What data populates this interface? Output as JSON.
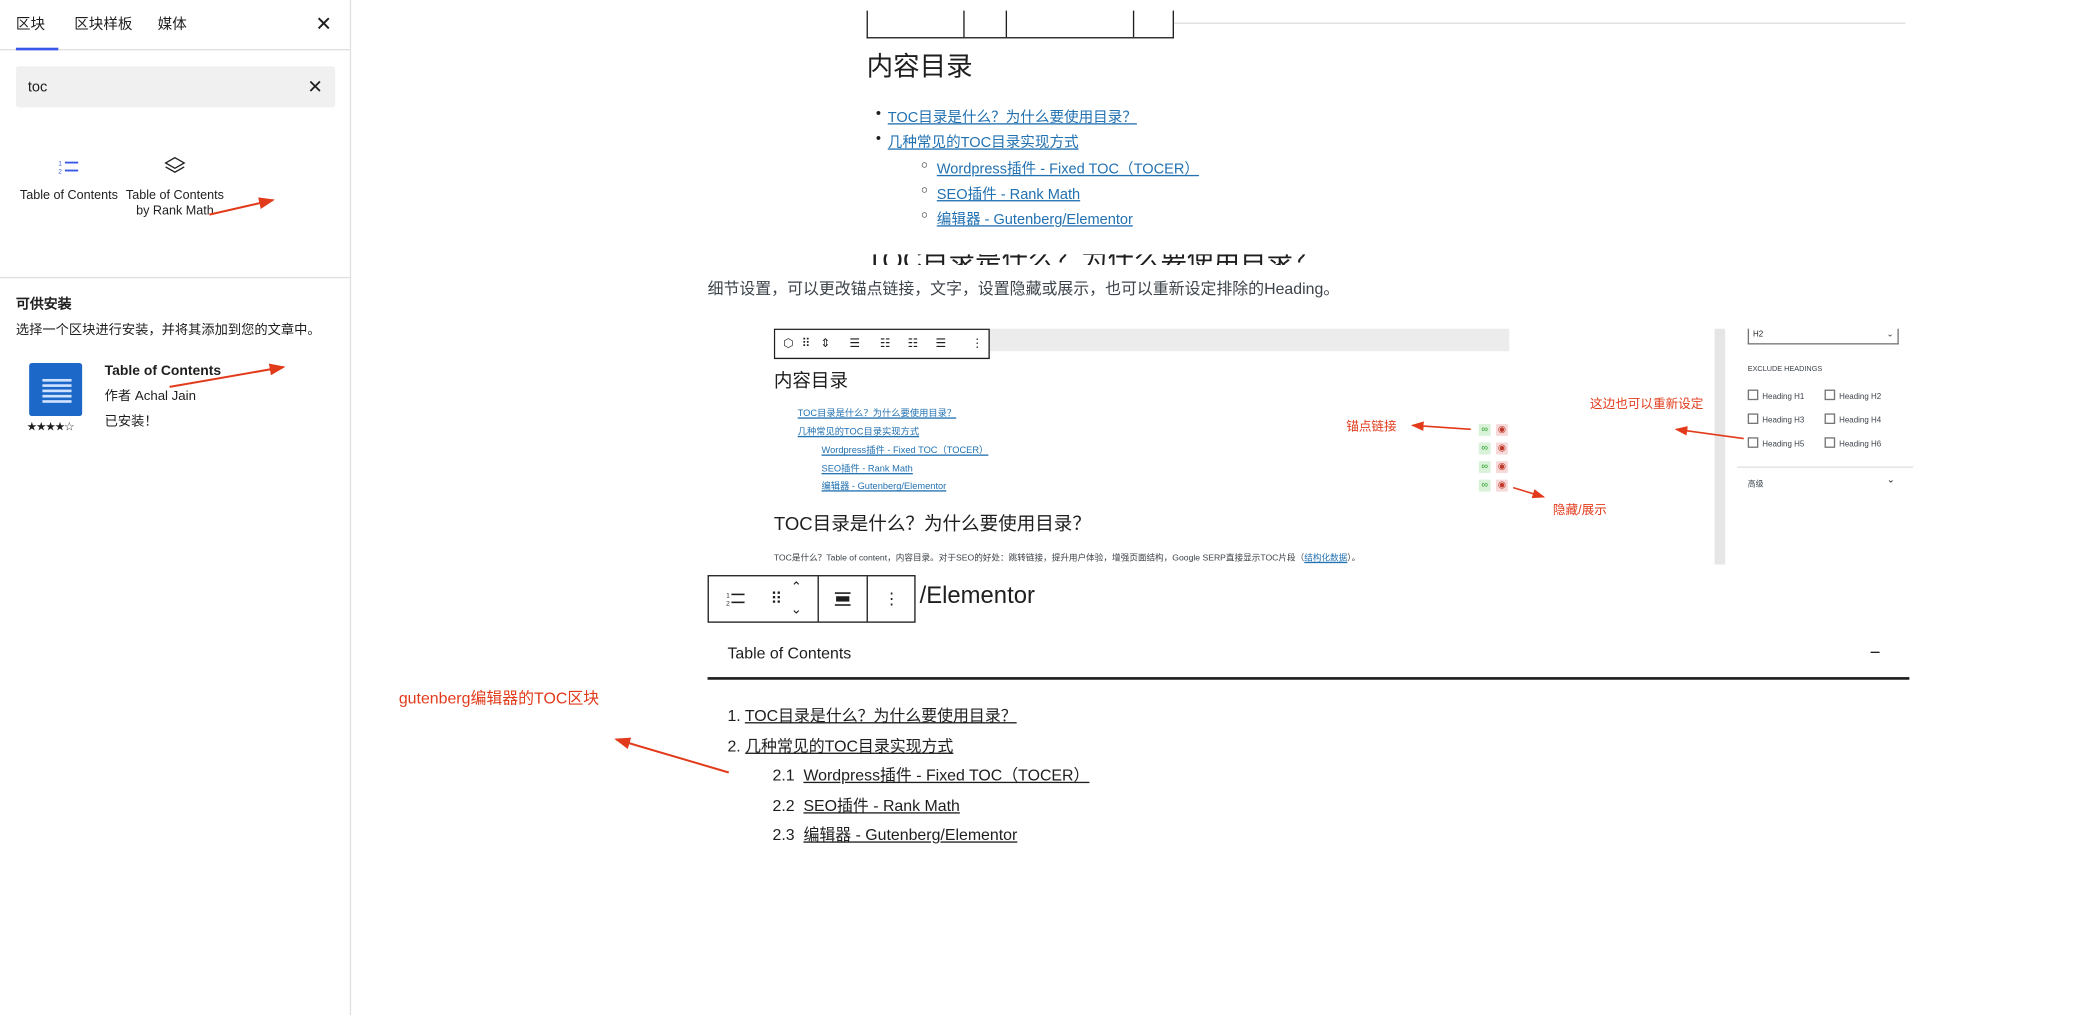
{
  "sidebar": {
    "tabs": [
      "区块",
      "区块样板",
      "媒体"
    ],
    "close": "✕",
    "search": {
      "value": "toc",
      "clear": "✕"
    },
    "blocks": [
      {
        "label": "Table of Contents",
        "icon": "numbered-list-icon"
      },
      {
        "label": "Table of Contents by Rank Math",
        "icon": "cube-icon"
      }
    ],
    "install_heading": "可供安装",
    "install_desc": "选择一个区块进行安装，并将其添加到您的文章中。",
    "plugin": {
      "title": "Table of Contents",
      "author": "作者 Achal Jain",
      "stars": "★★★★☆",
      "status": "已安装！"
    }
  },
  "main": {
    "toc_heading": "内容目录",
    "toc_items": [
      "TOC目录是什么？为什么要使用目录？",
      "几种常见的TOC目录实现方式"
    ],
    "toc_sub": [
      "Wordpress插件 - Fixed TOC（TOCER）",
      "SEO插件 - Rank Math",
      "编辑器 - Gutenberg/Elementor"
    ],
    "cut_heading": "TOC目录是什么？为什么要使用目录？",
    "detail_text": "细节设置，可以更改锚点链接，文字，设置隐藏或展示，也可以重新设定排除的Heading。",
    "shot": {
      "heading": "内容目录",
      "items": [
        "TOC目录是什么？为什么要使用目录？",
        "几种常见的TOC目录实现方式"
      ],
      "sub": [
        "Wordpress插件 - Fixed TOC（TOCER）",
        "SEO插件 - Rank Math",
        "编辑器 - Gutenberg/Elementor"
      ],
      "h2": "TOC目录是什么？为什么要使用目录？",
      "para_prefix": "TOC是什么？Table of content，内容目录。对于SEO的好处：跳转链接，提升用户体验，增强页面结构，Google SERP直接显示TOC片段（",
      "para_link": "结构化数据",
      "para_suffix": "）。",
      "select_value": "H2",
      "exclude_label": "EXCLUDE HEADINGS",
      "checks": [
        "Heading H1",
        "Heading H2",
        "Heading H3",
        "Heading H4",
        "Heading H5",
        "Heading H6"
      ],
      "advanced": "高级"
    },
    "elementor_text": "/Elementor",
    "toc_block": {
      "title": "Table of Contents",
      "collapse": "−",
      "items": [
        {
          "num": "1.",
          "text": "TOC目录是什么？为什么要使用目录？"
        },
        {
          "num": "2.",
          "text": "几种常见的TOC目录实现方式"
        }
      ],
      "sub": [
        {
          "num": "2.1",
          "text": "Wordpress插件 - Fixed TOC（TOCER）"
        },
        {
          "num": "2.2",
          "text": "SEO插件 - Rank Math"
        },
        {
          "num": "2.3",
          "text": "编辑器 - Gutenberg/Elementor"
        }
      ]
    }
  },
  "annotations": {
    "anchor": "锚点链接",
    "reset": "这边也可以重新设定",
    "hide": "隐藏/展示",
    "gutenberg": "gutenberg编辑器的TOC区块",
    "color": "#e23b1b"
  }
}
